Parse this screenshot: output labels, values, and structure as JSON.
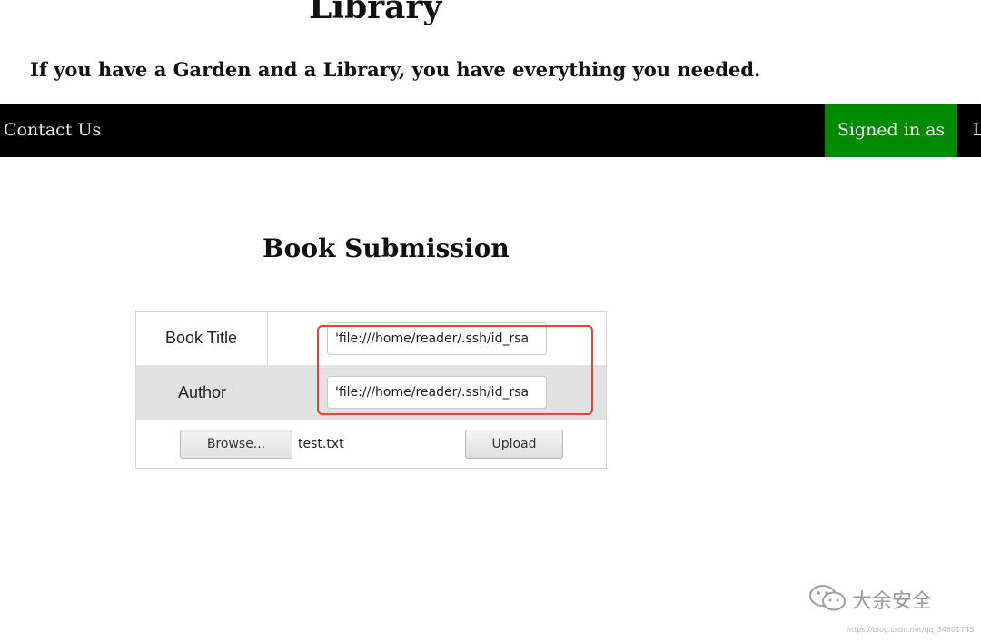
{
  "header": {
    "site_title": "Library",
    "tagline": "If you have a Garden and a Library, you have everything you needed."
  },
  "nav": {
    "contact": "Contact Us",
    "signed_in": "Signed in as",
    "extra": "L"
  },
  "form": {
    "title": "Book Submission",
    "book_title_label": "Book Title",
    "book_title_value": "'file:///home/reader/.ssh/id_rsa",
    "author_label": "Author",
    "author_value": "'file:///home/reader/.ssh/id_rsa",
    "browse_label": "Browse...",
    "file_name": "test.txt",
    "upload_label": "Upload"
  },
  "colors": {
    "navbar": "#000000",
    "signed_in_bg": "#008a00",
    "highlight": "#e0463c"
  },
  "watermark": {
    "text": "大余安全",
    "url": "https://blog.csdn.net/qq_34801745"
  }
}
